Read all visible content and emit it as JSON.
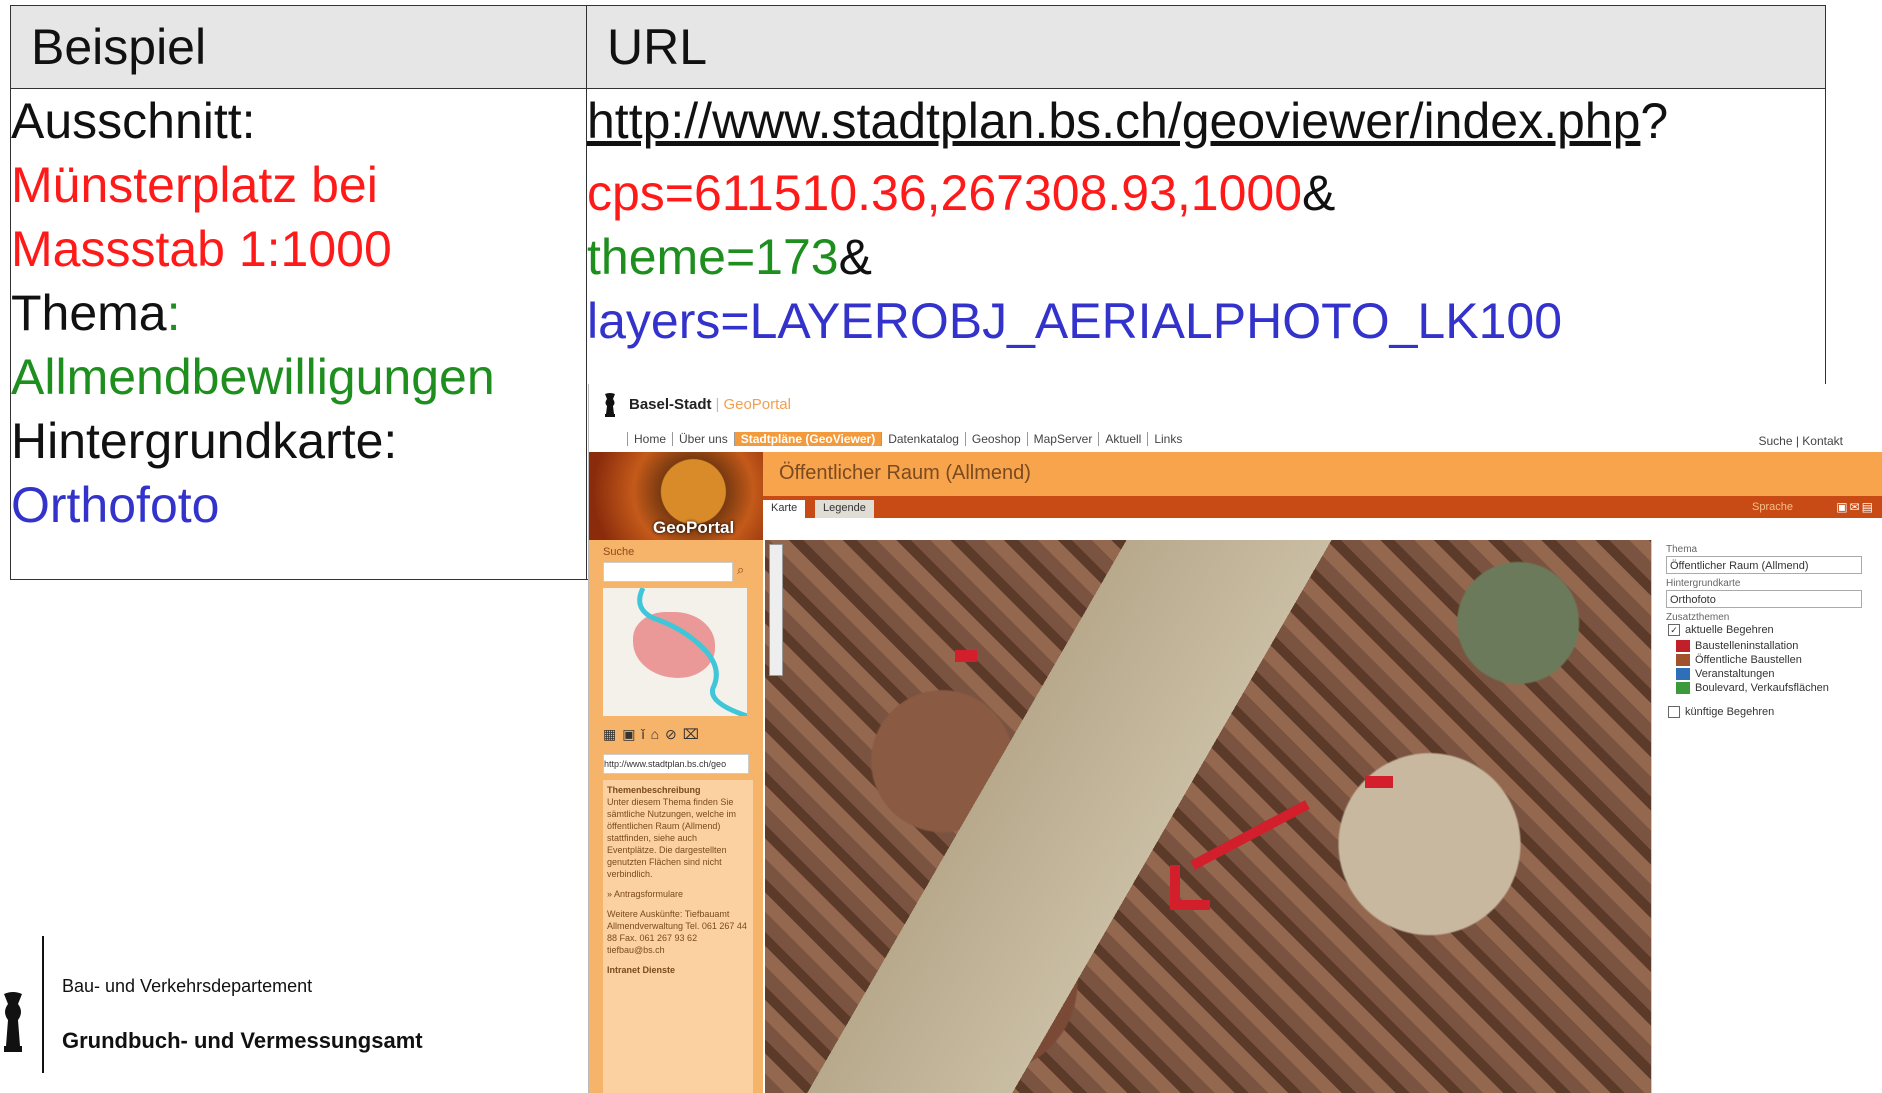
{
  "table": {
    "header_col1": "Beispiel",
    "header_col2": "URL",
    "left": {
      "ausschnitt_label": "Ausschnitt:",
      "ausschnitt_value_line1": "Münsterplatz bei",
      "ausschnitt_value_line2": "Massstab 1:1000",
      "thema_label": "Thema",
      "thema_colon": ":",
      "thema_value": "Allmendbewilligungen",
      "hintergrund_label": "Hintergrundkarte:",
      "hintergrund_value": "Orthofoto"
    },
    "right": {
      "url_base": "http://www.stadtplan.bs.ch/geoviewer/index.php",
      "url_question": "?",
      "param_cps": "cps=611510.36,267308.93,1000",
      "param_theme": "theme=173",
      "param_layers": "layers=LAYEROBJ_AERIALPHOTO_LK100",
      "amp": "&"
    }
  },
  "footer": {
    "department": "Bau- und Verkehrsdepartement",
    "office": "Grundbuch- und Vermessungsamt"
  },
  "screenshot": {
    "brand": "Basel-Stadt",
    "brand_sep": "|",
    "brand_suffix": "GeoPortal",
    "nav": [
      "Home",
      "Über uns",
      "Stadtpläne (GeoViewer)",
      "Datenkatalog",
      "Geoshop",
      "MapServer",
      "Aktuell",
      "Links"
    ],
    "nav_right": "Suche | Kontakt",
    "page_title": "Öffentlicher Raum (Allmend)",
    "tab_karte": "Karte",
    "tab_legende": "Legende",
    "sprache": "Sprache",
    "logo_label": "GeoPortal",
    "search_label": "Suche",
    "url_field": "http://www.stadtplan.bs.ch/geo",
    "desc_title": "Themenbeschreibung",
    "desc_text": "Unter diesem Thema finden Sie sämtliche Nutzungen, welche im öffentlichen Raum (Allmend) stattfinden, siehe auch Eventplätze. Die dargestellten genutzten Flächen sind nicht verbindlich.",
    "desc_link": "» Antragsformulare",
    "desc_contact": "Weitere Auskünfte: Tiefbauamt Allmendverwaltung Tel. 061 267 44 88 Fax. 061 267 93 62 tiefbau@bs.ch",
    "desc_footer": "Intranet Dienste",
    "legend": {
      "thema_label": "Thema",
      "thema_value": "Öffentlicher Raum (Allmend)",
      "hintergrund_label": "Hintergrundkarte",
      "hintergrund_value": "Orthofoto",
      "zusatz_label": "Zusatzthemen",
      "group1": "aktuelle Begehren",
      "items": [
        "Baustelleninstallation",
        "Öffentliche Baustellen",
        "Veranstaltungen",
        "Boulevard, Verkaufsflächen"
      ],
      "item_colors": [
        "#c0202a",
        "#a0522d",
        "#2e6fb8",
        "#3c9a3c"
      ],
      "group2": "künftige Begehren"
    }
  }
}
